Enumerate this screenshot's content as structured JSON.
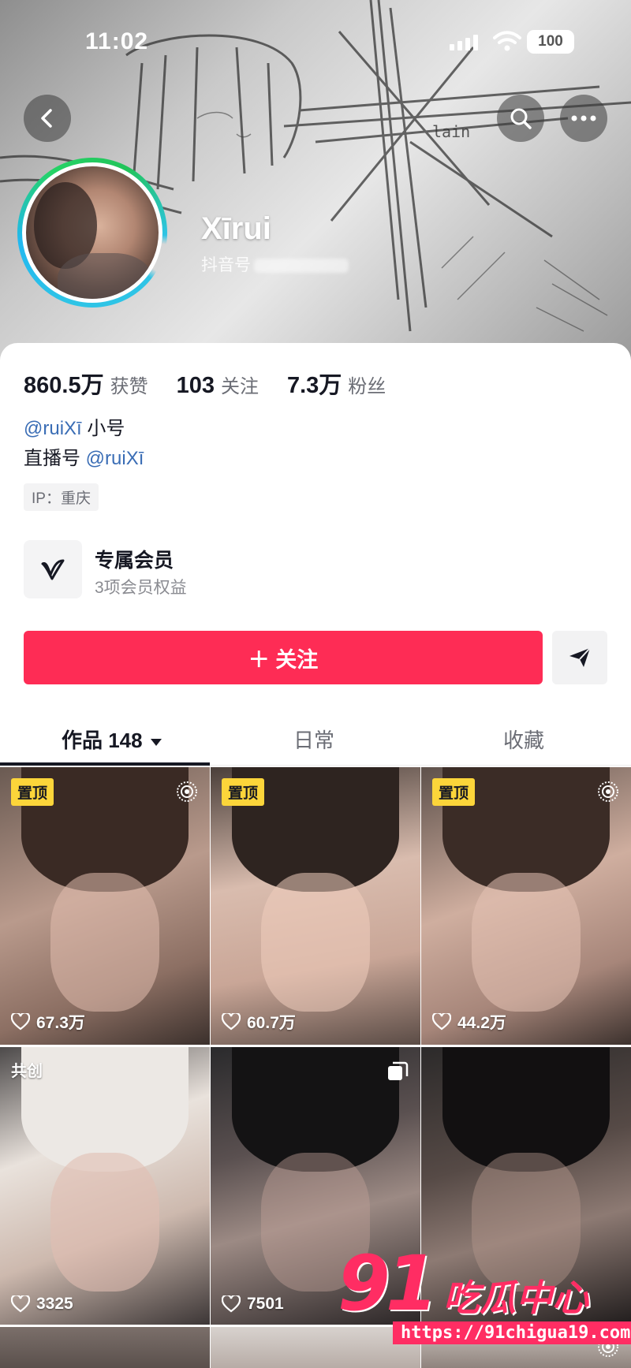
{
  "status_bar": {
    "time": "11:02",
    "battery": "100"
  },
  "profile": {
    "nickname": "Xīrui",
    "douyin_id_label": "抖音号",
    "stats": [
      {
        "value": "860.5万",
        "label": "获赞"
      },
      {
        "value": "103",
        "label": "关注"
      },
      {
        "value": "7.3万",
        "label": "粉丝"
      }
    ],
    "bio": {
      "line1_mention": "@ruiXī",
      "line1_suffix": " 小号",
      "line2_prefix": "直播号 ",
      "line2_mention": "@ruiXī"
    },
    "ip": "IP：重庆"
  },
  "membership": {
    "title": "专属会员",
    "subtitle": "3项会员权益"
  },
  "actions": {
    "follow_label": "＋ 关注"
  },
  "tabs": [
    {
      "label": "作品 148"
    },
    {
      "label": "日常"
    },
    {
      "label": "收藏"
    }
  ],
  "videos": [
    {
      "tag": "置顶",
      "likes": "67.3万",
      "corner_icon": "live-photo-icon"
    },
    {
      "tag": "置顶",
      "likes": "60.7万",
      "corner_icon": ""
    },
    {
      "tag": "置顶",
      "likes": "44.2万",
      "corner_icon": "live-photo-icon"
    },
    {
      "tag": "共创",
      "likes": "3325",
      "corner_icon": ""
    },
    {
      "tag": "",
      "likes": "7501",
      "corner_icon": "gallery-icon"
    },
    {
      "tag": "",
      "likes": "",
      "corner_icon": ""
    }
  ],
  "watermark": {
    "number": "91",
    "text": "吃瓜中心",
    "url": "https://91chigua19.com"
  },
  "colors": {
    "accent": "#fe2c55",
    "pin_tag": "#fcd53a",
    "mention": "#3a6db5"
  }
}
